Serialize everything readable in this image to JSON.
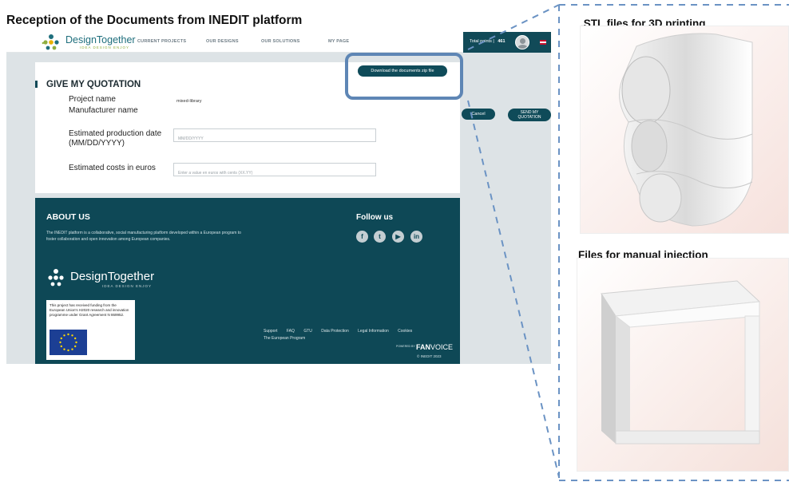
{
  "figure_title": "Reception of the Documents from INEDIT platform",
  "navbar": {
    "logo_text": "DesignTogether",
    "logo_tagline": "IDEA DESIGN ENJOY",
    "items": [
      "CURRENT PROJECTS",
      "OUR DESIGNS",
      "OUR SOLUTIONS",
      "MY PAGE"
    ],
    "points_label": "Total points",
    "points_value": "461"
  },
  "quotation": {
    "heading": "GIVE MY QUOTATION",
    "project_label": "Project name",
    "project_value": "mixed-library",
    "manufacturer_label": "Manufacturer name",
    "date_label_line1": "Estimated production date",
    "date_label_line2": "(MM/DD/YYYY)",
    "date_placeholder": "MM/DD/YYYY",
    "costs_label": "Estimated costs in euros",
    "costs_placeholder": "Enter a value en euros with cents (XX.YY)"
  },
  "buttons": {
    "download": "Download the documents zip file",
    "cancel": "Cancel",
    "send_line1": "SEND MY",
    "send_line2": "QUOTATION"
  },
  "footer": {
    "about_title": "ABOUT US",
    "about_text": "The INEDIT platform is a collaborative, social manufacturing platform developed within a European program to foster collaboration and open innovation among European companies.",
    "follow_title": "Follow us",
    "social_icons": [
      "facebook-icon",
      "twitter-icon",
      "youtube-icon",
      "linkedin-icon"
    ],
    "social_glyphs": [
      "f",
      "t",
      "▶",
      "in"
    ],
    "logo_text": "DesignTogether",
    "logo_tagline": "IDEA DESIGN ENJOY",
    "funding_text": "This project has received funding from the European Union's H2020 research and innovation programme under Grant Agreement N 869952.",
    "links": [
      "Support",
      "FAQ",
      "GTU",
      "Data Protection",
      "Legal Information",
      "Cookies"
    ],
    "program_link": "The European Program",
    "powered_by": "POWERED BY",
    "fanvoice_bold": "FAN",
    "fanvoice_rest": "VOICE",
    "copyright": "© INEDIT 2023"
  },
  "right_panels": {
    "stl_title": ".STL files for 3D printing",
    "manual_title": "Files for manual injection"
  },
  "colors": {
    "brand_dark": "#0f4b59",
    "highlight_blue": "#5e86b5",
    "logo_green": "#8fae3f",
    "logo_teal": "#1f6f7d"
  }
}
